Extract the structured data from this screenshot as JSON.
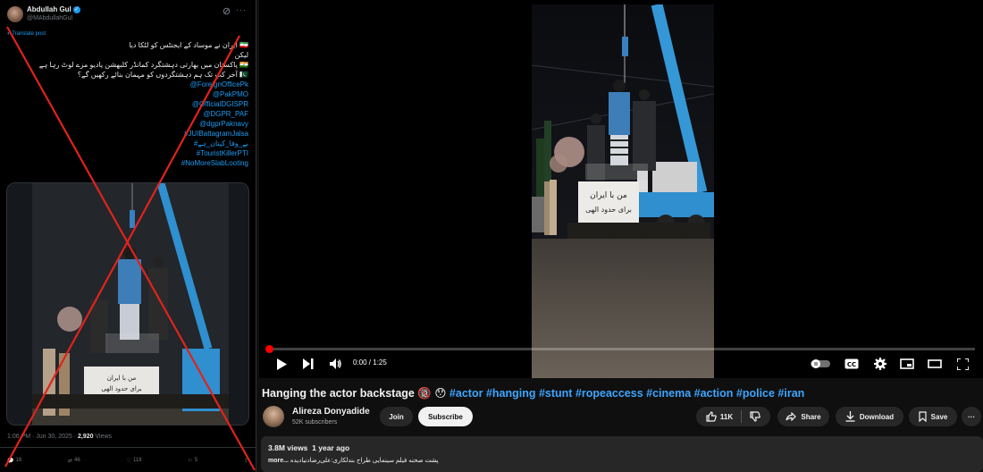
{
  "tweet": {
    "author_name": "Abdullah Gul",
    "handle": "@MAbdullahGul",
    "translate_label": "Translate post",
    "lines": [
      "ایران نے موساد کے ایجنٹس کو لٹکا دیا",
      "لیکن",
      "پاکستان میں بھارتی دہشتگرد کمانڈر کلبھشن یادیو مزے لوٹ رہا ہے",
      "آخر کب تک ہم دہشتگردوں کو مہمان بنائے رکھیں گے؟"
    ],
    "mentions": [
      "@ForeignOfficePk",
      "@PakPMO",
      "@OfficialDGISPR",
      "@DGPR_PAF",
      "@dgprPaknavy",
      "#JUIBattagramJalsa",
      "#بے_وفا_کپتان_ہے",
      "#TouristKillerPTI",
      "#NoMoreSlabLooting"
    ],
    "timestamp": "1:06 PM · Jun 30, 2025",
    "views_count": "2,920",
    "views_label": "Views",
    "replies": "18",
    "reposts": "46",
    "likes": "118",
    "bookmarks": "5",
    "share": ""
  },
  "youtube": {
    "time": "0:00 / 1:25",
    "title_text": "Hanging the actor backstage",
    "title_emoji": "🔞 😯",
    "hashtags": "#actor #hanging #stunt #ropeaccess #cinema #action #police #iran",
    "channel_name": "Alireza Donyadide",
    "subscribers": "52K subscribers",
    "join_label": "Join",
    "subscribe_label": "Subscribe",
    "likes": "11K",
    "share_label": "Share",
    "download_label": "Download",
    "save_label": "Save",
    "views": "3.8M views",
    "age": "1 year ago",
    "description": "پشت صحنه فیلم سینمایی طراح بندلکاری:علی‌رضا‌دنیادیده",
    "more_label": "...more"
  },
  "video_banner": {
    "line1": "من با ایران",
    "line2": "برای حدود الهی"
  },
  "colors": {
    "link": "#1d9bf0",
    "yt_link": "#3ea6ff",
    "yt_red": "#ff0000",
    "cross": "#e0231c"
  }
}
